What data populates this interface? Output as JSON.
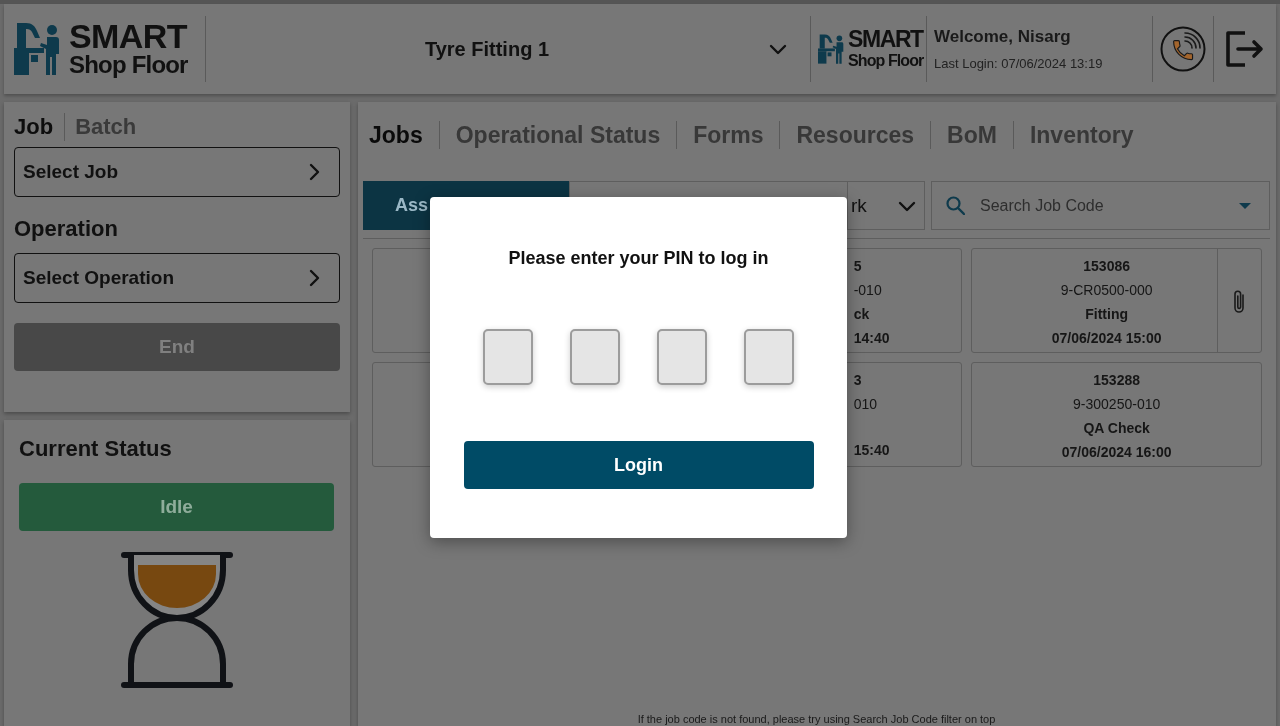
{
  "header": {
    "logo": {
      "line_1": "SMART",
      "line_2": "Shop Floor"
    },
    "line_select": {
      "value": "Tyre Fitting 1"
    },
    "customer_logo": {
      "line_1": "SMART",
      "line_2": "Shop Floor"
    },
    "user": {
      "welcome": "Welcome, Nisarg",
      "last_login": "Last Login: 07/06/2024 13:19"
    }
  },
  "selection_panel": {
    "tabs": [
      {
        "label": "Job",
        "selected": true
      },
      {
        "label": "Batch",
        "selected": false
      }
    ],
    "job_picker": {
      "label": "Select Job"
    },
    "operation_heading": "Operation",
    "operation_picker": {
      "label": "Select Operation"
    },
    "end_button": {
      "label": "End",
      "disabled": true
    }
  },
  "status_panel": {
    "title": "Current Status",
    "status": "Idle"
  },
  "main_tabs": [
    {
      "label": "Jobs",
      "selected": true
    },
    {
      "label": "Operational Status",
      "selected": false
    },
    {
      "label": "Forms",
      "selected": false
    },
    {
      "label": "Resources",
      "selected": false
    },
    {
      "label": "BoM",
      "selected": false
    },
    {
      "label": "Inventory",
      "selected": false
    }
  ],
  "job_filter": {
    "toggle": [
      {
        "label": "Ass",
        "selected": true
      },
      {
        "selected": false
      }
    ],
    "dropdown": {
      "value": "rk"
    },
    "search": {
      "placeholder": "Search Job Code"
    }
  },
  "job_cards": [
    {
      "kind": "hidden"
    },
    {
      "kind": "clipped",
      "job_number": "5",
      "part_number": "-010",
      "operation": "ck",
      "due": "14:40",
      "attachment": false
    },
    {
      "kind": "full",
      "job_number": "153086",
      "part_number": "9-CR0500-000",
      "operation": "Fitting",
      "due": "07/06/2024 15:00",
      "attachment": true
    },
    {
      "kind": "hidden"
    },
    {
      "kind": "clipped",
      "job_number": "3",
      "part_number": "010",
      "due": "15:40",
      "attachment": false
    },
    {
      "kind": "full",
      "job_number": "153288",
      "part_number": "9-300250-010",
      "operation": "QA Check",
      "due": "07/06/2024 16:00",
      "attachment": false
    }
  ],
  "hint": "If the job code is not found, please try using Search Job Code filter on top",
  "pin_dialog": {
    "title": "Please enter your PIN to log in",
    "pin_fields": [
      {
        "filled": false
      },
      {
        "filled": false
      },
      {
        "filled": false
      },
      {
        "filled": false
      }
    ],
    "login_button": {
      "label": "Login"
    }
  }
}
